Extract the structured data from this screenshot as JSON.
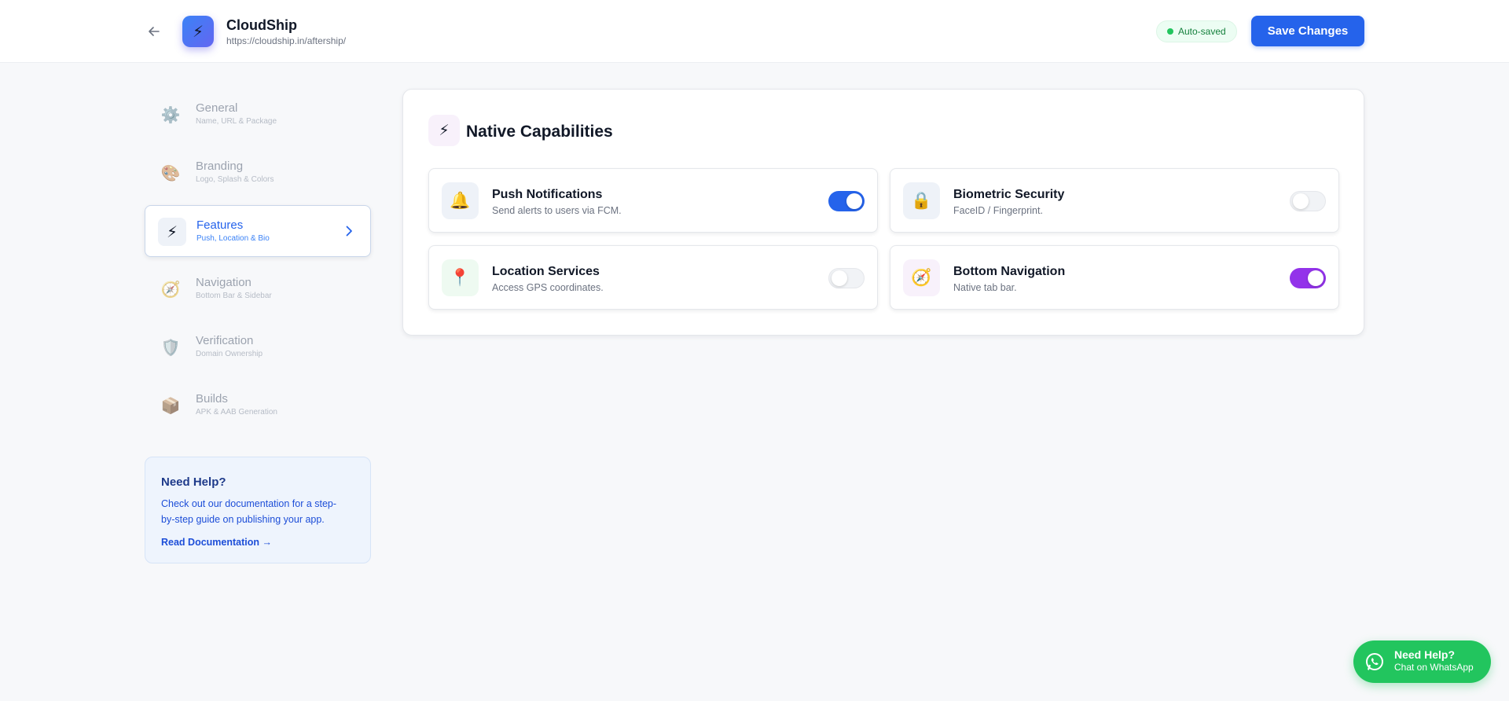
{
  "header": {
    "app_name": "CloudShip",
    "app_url": "https://cloudship.in/aftership/",
    "logo_icon": "lightning-bolt",
    "status_badge": "Auto-saved",
    "save_label": "Save Changes",
    "accent_color": "#2563eb"
  },
  "sidebar": {
    "items": [
      {
        "label": "General",
        "sub": "Name, URL & Package",
        "icon": "gear-icon",
        "active": false
      },
      {
        "label": "Branding",
        "sub": "Logo, Splash & Colors",
        "icon": "palette-icon",
        "active": false
      },
      {
        "label": "Features",
        "sub": "Push, Location & Bio",
        "icon": "lightning-icon",
        "active": true
      },
      {
        "label": "Navigation",
        "sub": "Bottom Bar & Sidebar",
        "icon": "compass-icon",
        "active": false
      },
      {
        "label": "Verification",
        "sub": "Domain Ownership",
        "icon": "shield-icon",
        "active": false
      },
      {
        "label": "Builds",
        "sub": "APK & AAB Generation",
        "icon": "package-icon",
        "active": false
      }
    ],
    "help": {
      "title": "Need Help?",
      "text": "Check out our documentation for a step-by-step guide on publishing your app.",
      "link": "Read Documentation →"
    }
  },
  "main": {
    "section_title": "Native Capabilities",
    "section_icon": "lightning-icon",
    "capabilities": [
      {
        "title": "Push Notifications",
        "desc": "Send alerts to users via FCM.",
        "icon": "bell-icon",
        "enabled": true,
        "toggle_color": "#2563eb"
      },
      {
        "title": "Biometric Security",
        "desc": "FaceID / Fingerprint.",
        "icon": "lock-icon",
        "enabled": false,
        "toggle_color": "#f1f3f6"
      },
      {
        "title": "Location Services",
        "desc": "Access GPS coordinates.",
        "icon": "pin-icon",
        "enabled": false,
        "toggle_color": "#f1f3f6"
      },
      {
        "title": "Bottom Navigation",
        "desc": "Native tab bar.",
        "icon": "compass-icon",
        "enabled": true,
        "toggle_color": "#9333ea"
      }
    ]
  },
  "whatsapp": {
    "title": "Need Help?",
    "sub": "Chat on WhatsApp",
    "color": "#22c55e"
  }
}
